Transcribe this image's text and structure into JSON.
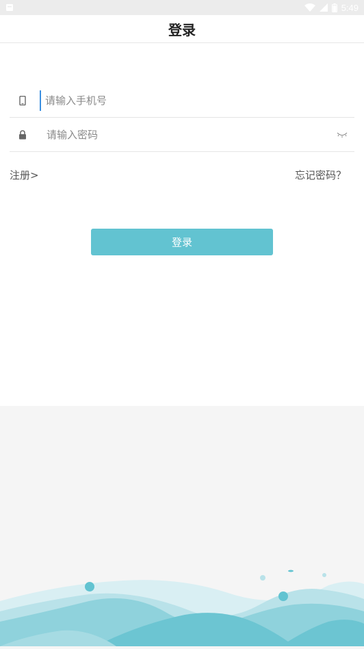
{
  "status_bar": {
    "time": "5:49",
    "icons": [
      "notification-icon",
      "wifi-icon",
      "signal-icon",
      "battery-icon"
    ]
  },
  "header": {
    "title": "登录"
  },
  "form": {
    "phone": {
      "icon": "phone-icon",
      "placeholder": "请输入手机号",
      "value": ""
    },
    "password": {
      "icon": "lock-icon",
      "placeholder": "请输入密码",
      "value": "",
      "toggle_icon": "eye-closed-icon"
    }
  },
  "links": {
    "register": "注册>",
    "forgot": "忘记密码？"
  },
  "login_button": {
    "label": "登录"
  },
  "colors": {
    "accent": "#62c3d1",
    "wave_light": "#d6eef2",
    "wave_mid": "#9bd6df",
    "wave_dark": "#62c3d1",
    "background": "#f5f5f5"
  }
}
